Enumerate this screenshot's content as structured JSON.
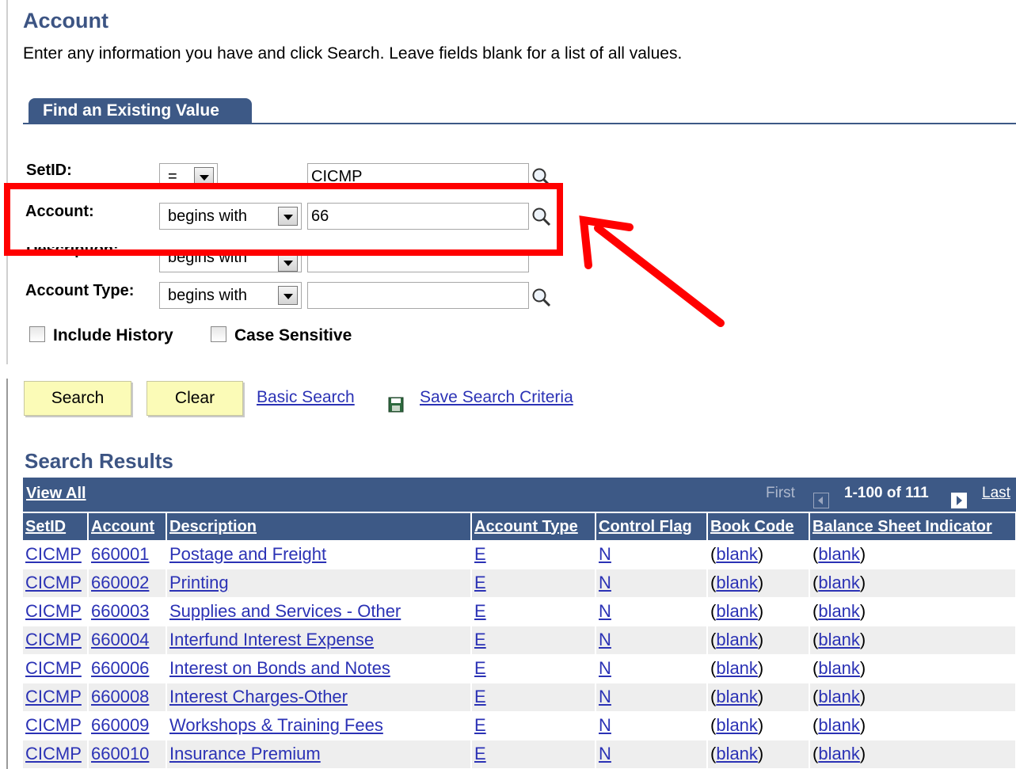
{
  "header": {
    "title": "Account",
    "instructions": "Enter any information you have and click Search. Leave fields blank for a list of all values."
  },
  "tab": {
    "label": "Find an Existing Value"
  },
  "form": {
    "setid": {
      "label": "SetID:",
      "operator": "=",
      "value": "CICMP"
    },
    "account": {
      "label": "Account:",
      "operator": "begins with",
      "value": "66"
    },
    "description": {
      "label": "Description:",
      "operator": "begins with",
      "value": ""
    },
    "account_type": {
      "label": "Account Type:",
      "operator": "begins with",
      "value": ""
    },
    "include_history": {
      "label": "Include History",
      "checked": false
    },
    "case_sensitive": {
      "label": "Case Sensitive",
      "checked": false
    }
  },
  "actions": {
    "search": "Search",
    "clear": "Clear",
    "basic_search": "Basic Search",
    "save_criteria": "Save Search Criteria"
  },
  "results": {
    "title": "Search Results",
    "view_all": "View All",
    "first": "First",
    "count": "1-100 of 111",
    "last": "Last",
    "columns": [
      "SetID",
      "Account",
      "Description",
      "Account Type",
      "Control Flag",
      "Book Code",
      "Balance Sheet Indicator"
    ],
    "rows": [
      {
        "setid": "CICMP",
        "account": "660001",
        "description": "Postage and Freight",
        "type": "E",
        "flag": "N",
        "book": "blank",
        "bsi": "blank"
      },
      {
        "setid": "CICMP",
        "account": "660002",
        "description": "Printing",
        "type": "E",
        "flag": "N",
        "book": "blank",
        "bsi": "blank"
      },
      {
        "setid": "CICMP",
        "account": "660003",
        "description": "Supplies and Services - Other",
        "type": "E",
        "flag": "N",
        "book": "blank",
        "bsi": "blank"
      },
      {
        "setid": "CICMP",
        "account": "660004",
        "description": "Interfund Interest Expense",
        "type": "E",
        "flag": "N",
        "book": "blank",
        "bsi": "blank"
      },
      {
        "setid": "CICMP",
        "account": "660006",
        "description": "Interest on Bonds and Notes",
        "type": "E",
        "flag": "N",
        "book": "blank",
        "bsi": "blank"
      },
      {
        "setid": "CICMP",
        "account": "660008",
        "description": "Interest Charges-Other",
        "type": "E",
        "flag": "N",
        "book": "blank",
        "bsi": "blank"
      },
      {
        "setid": "CICMP",
        "account": "660009",
        "description": "Workshops & Training Fees",
        "type": "E",
        "flag": "N",
        "book": "blank",
        "bsi": "blank"
      },
      {
        "setid": "CICMP",
        "account": "660010",
        "description": "Insurance Premium",
        "type": "E",
        "flag": "N",
        "book": "blank",
        "bsi": "blank"
      }
    ]
  },
  "icons": {
    "lookup": "magnifier-icon",
    "save": "floppy-disk-icon",
    "annotation": "red-arrow-annotation"
  },
  "colors": {
    "header_blue": "#3d5986",
    "title_blue": "#3c5483",
    "link_blue": "#2b32b5",
    "button_yellow": "#fbfbb7",
    "annotation_red": "#ff0000"
  }
}
